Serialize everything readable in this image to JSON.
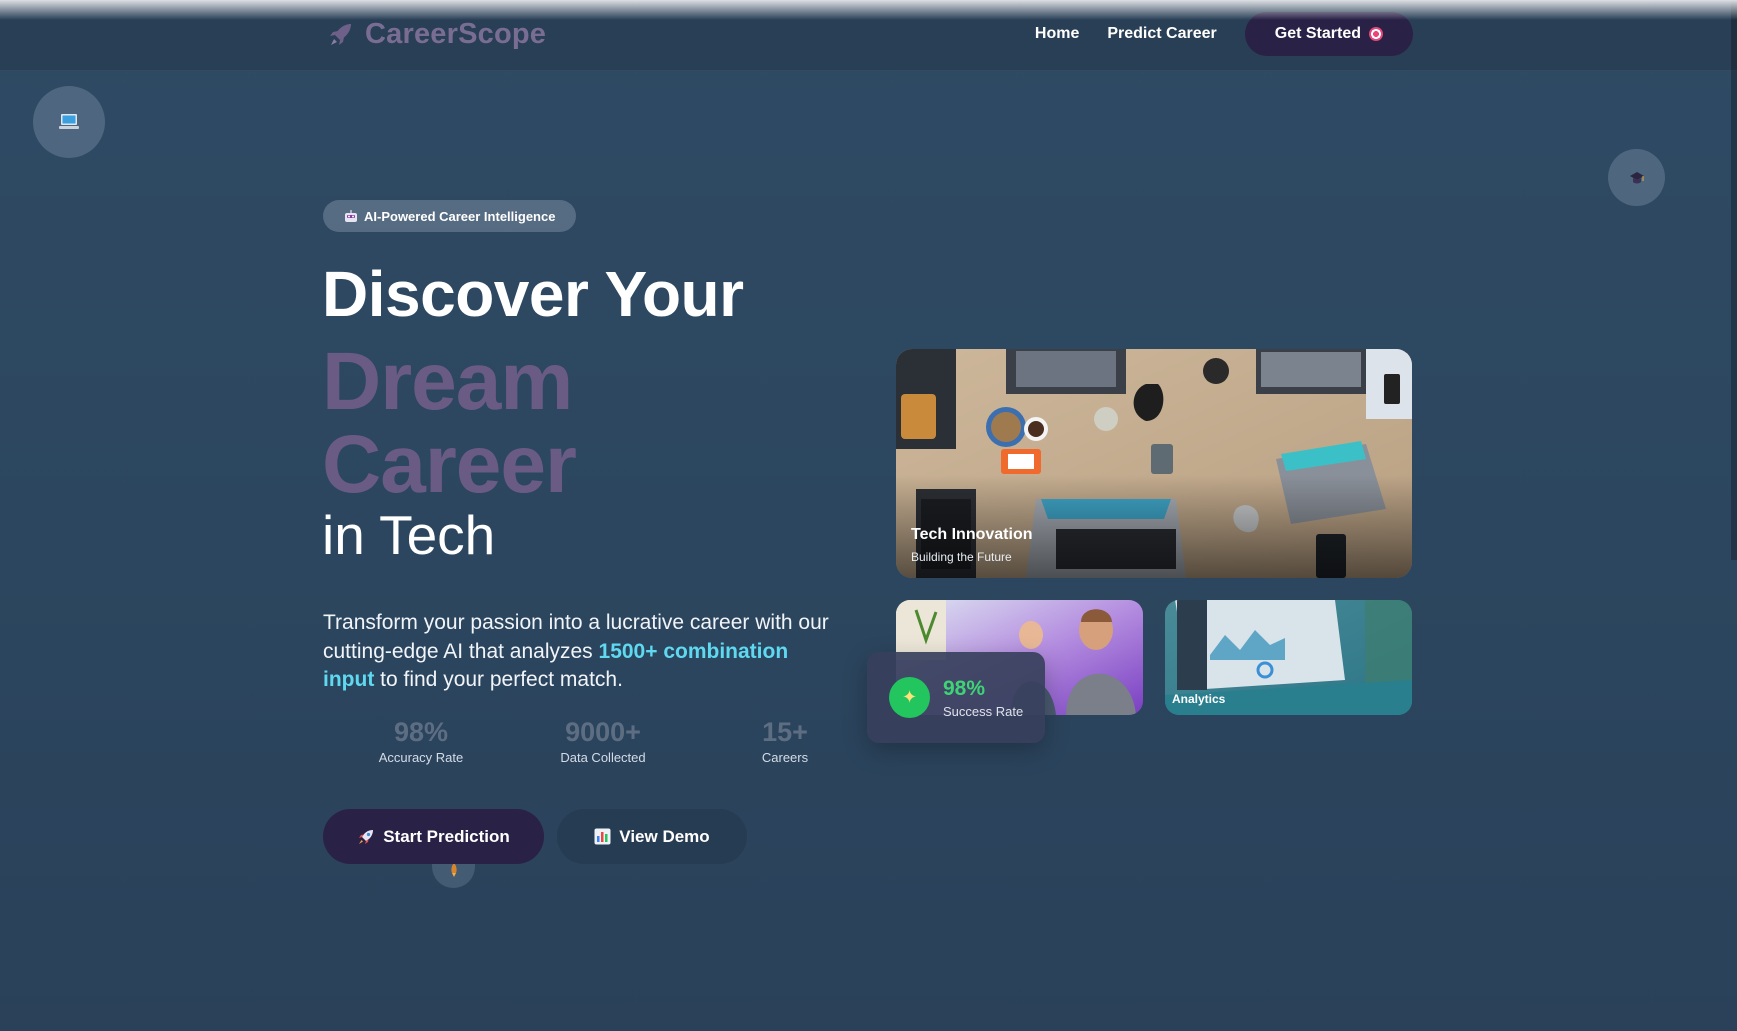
{
  "nav": {
    "brand": "CareerScope",
    "links": [
      "Home",
      "Predict Career"
    ],
    "cta": "Get Started"
  },
  "hero": {
    "badge": "AI-Powered Career Intelligence",
    "title_line1": "Discover Your",
    "title_line2": "Dream",
    "title_line3": "Career",
    "title_line4": "in Tech",
    "description_pre": "Transform your passion into a lucrative career with our cutting-edge AI that analyzes ",
    "description_highlight": "1500+ combination input",
    "description_post": " to find your perfect match.",
    "stats": [
      {
        "value": "98%",
        "label": "Accuracy Rate"
      },
      {
        "value": "9000+",
        "label": "Data Collected"
      },
      {
        "value": "15+",
        "label": "Careers"
      }
    ],
    "primary_button": "Start Prediction",
    "secondary_button": "View Demo"
  },
  "gallery": {
    "main_title": "Tech Innovation",
    "main_subtitle": "Building the Future",
    "analytics_label": "Analytics",
    "success_value": "98%",
    "success_label": "Success Rate"
  },
  "colors": {
    "background": "#2f4a64",
    "brand": "#7a6d94",
    "accent_highlight": "#5fd9f0",
    "button_dark": "#2a2146",
    "success_green": "#22c55e"
  },
  "icons": {
    "brand": "rocket-icon",
    "cta": "target-icon",
    "badge": "robot-icon",
    "primary_button": "rocket-icon",
    "secondary_button": "bar-chart-icon",
    "success": "sparkle-icon",
    "floating": [
      "laptop-icon",
      "graduation-cap-icon",
      "rocket-icon"
    ]
  }
}
